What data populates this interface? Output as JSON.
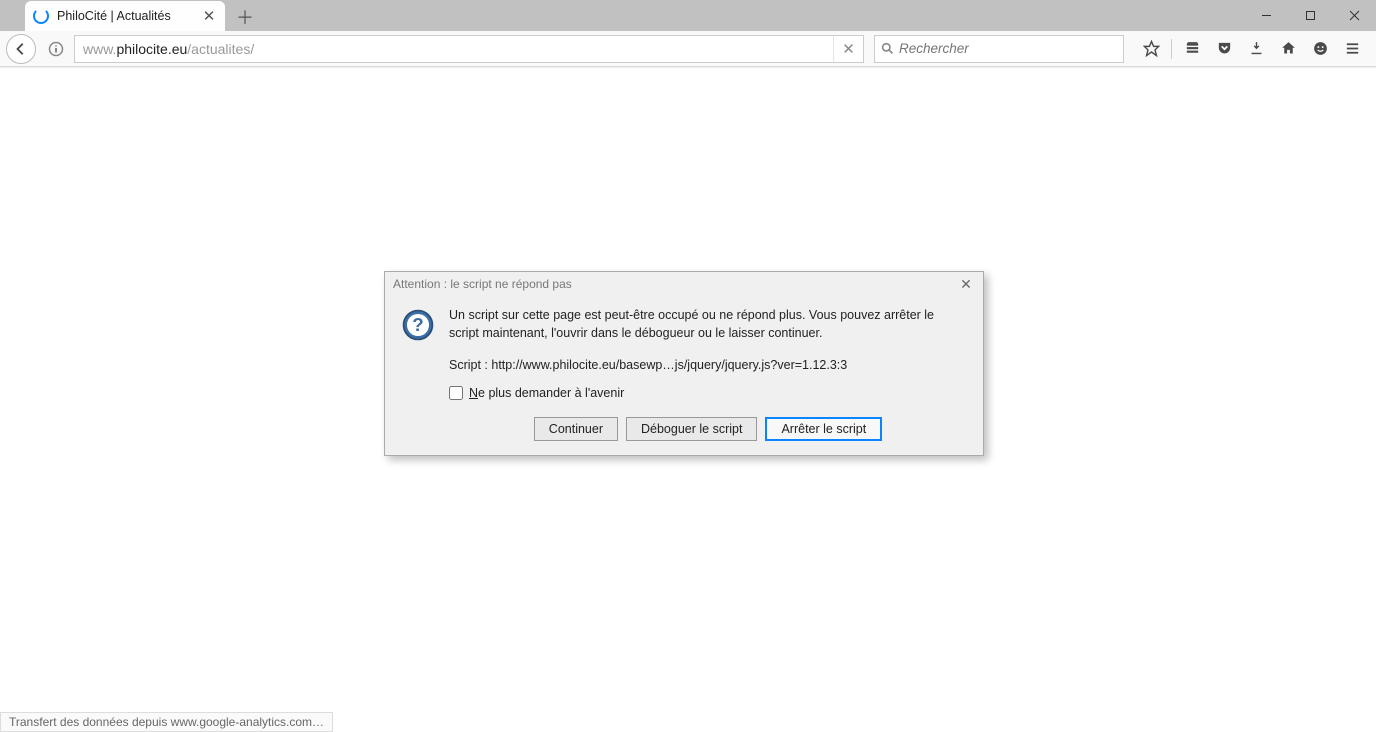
{
  "tab": {
    "title": "PhiloCité | Actualités"
  },
  "urlbar": {
    "host": "philocite.eu",
    "prefix": "www.",
    "path": "/actualites/"
  },
  "search": {
    "placeholder": "Rechercher"
  },
  "dialog": {
    "title": "Attention : le script ne répond pas",
    "message": "Un script sur cette page est peut-être occupé ou ne répond plus. Vous pouvez arrêter le script maintenant, l'ouvrir dans le débogueur ou le laisser continuer.",
    "script_label": "Script : http://www.philocite.eu/basewp…js/jquery/jquery.js?ver=1.12.3:3",
    "checkbox_label_pre": "N",
    "checkbox_label_rest": "e plus demander à l'avenir",
    "btn_continue": "Continuer",
    "btn_debug": "Déboguer le script",
    "btn_stop": "Arrêter le script"
  },
  "statusbar": {
    "text": "Transfert des données depuis www.google-analytics.com…"
  }
}
